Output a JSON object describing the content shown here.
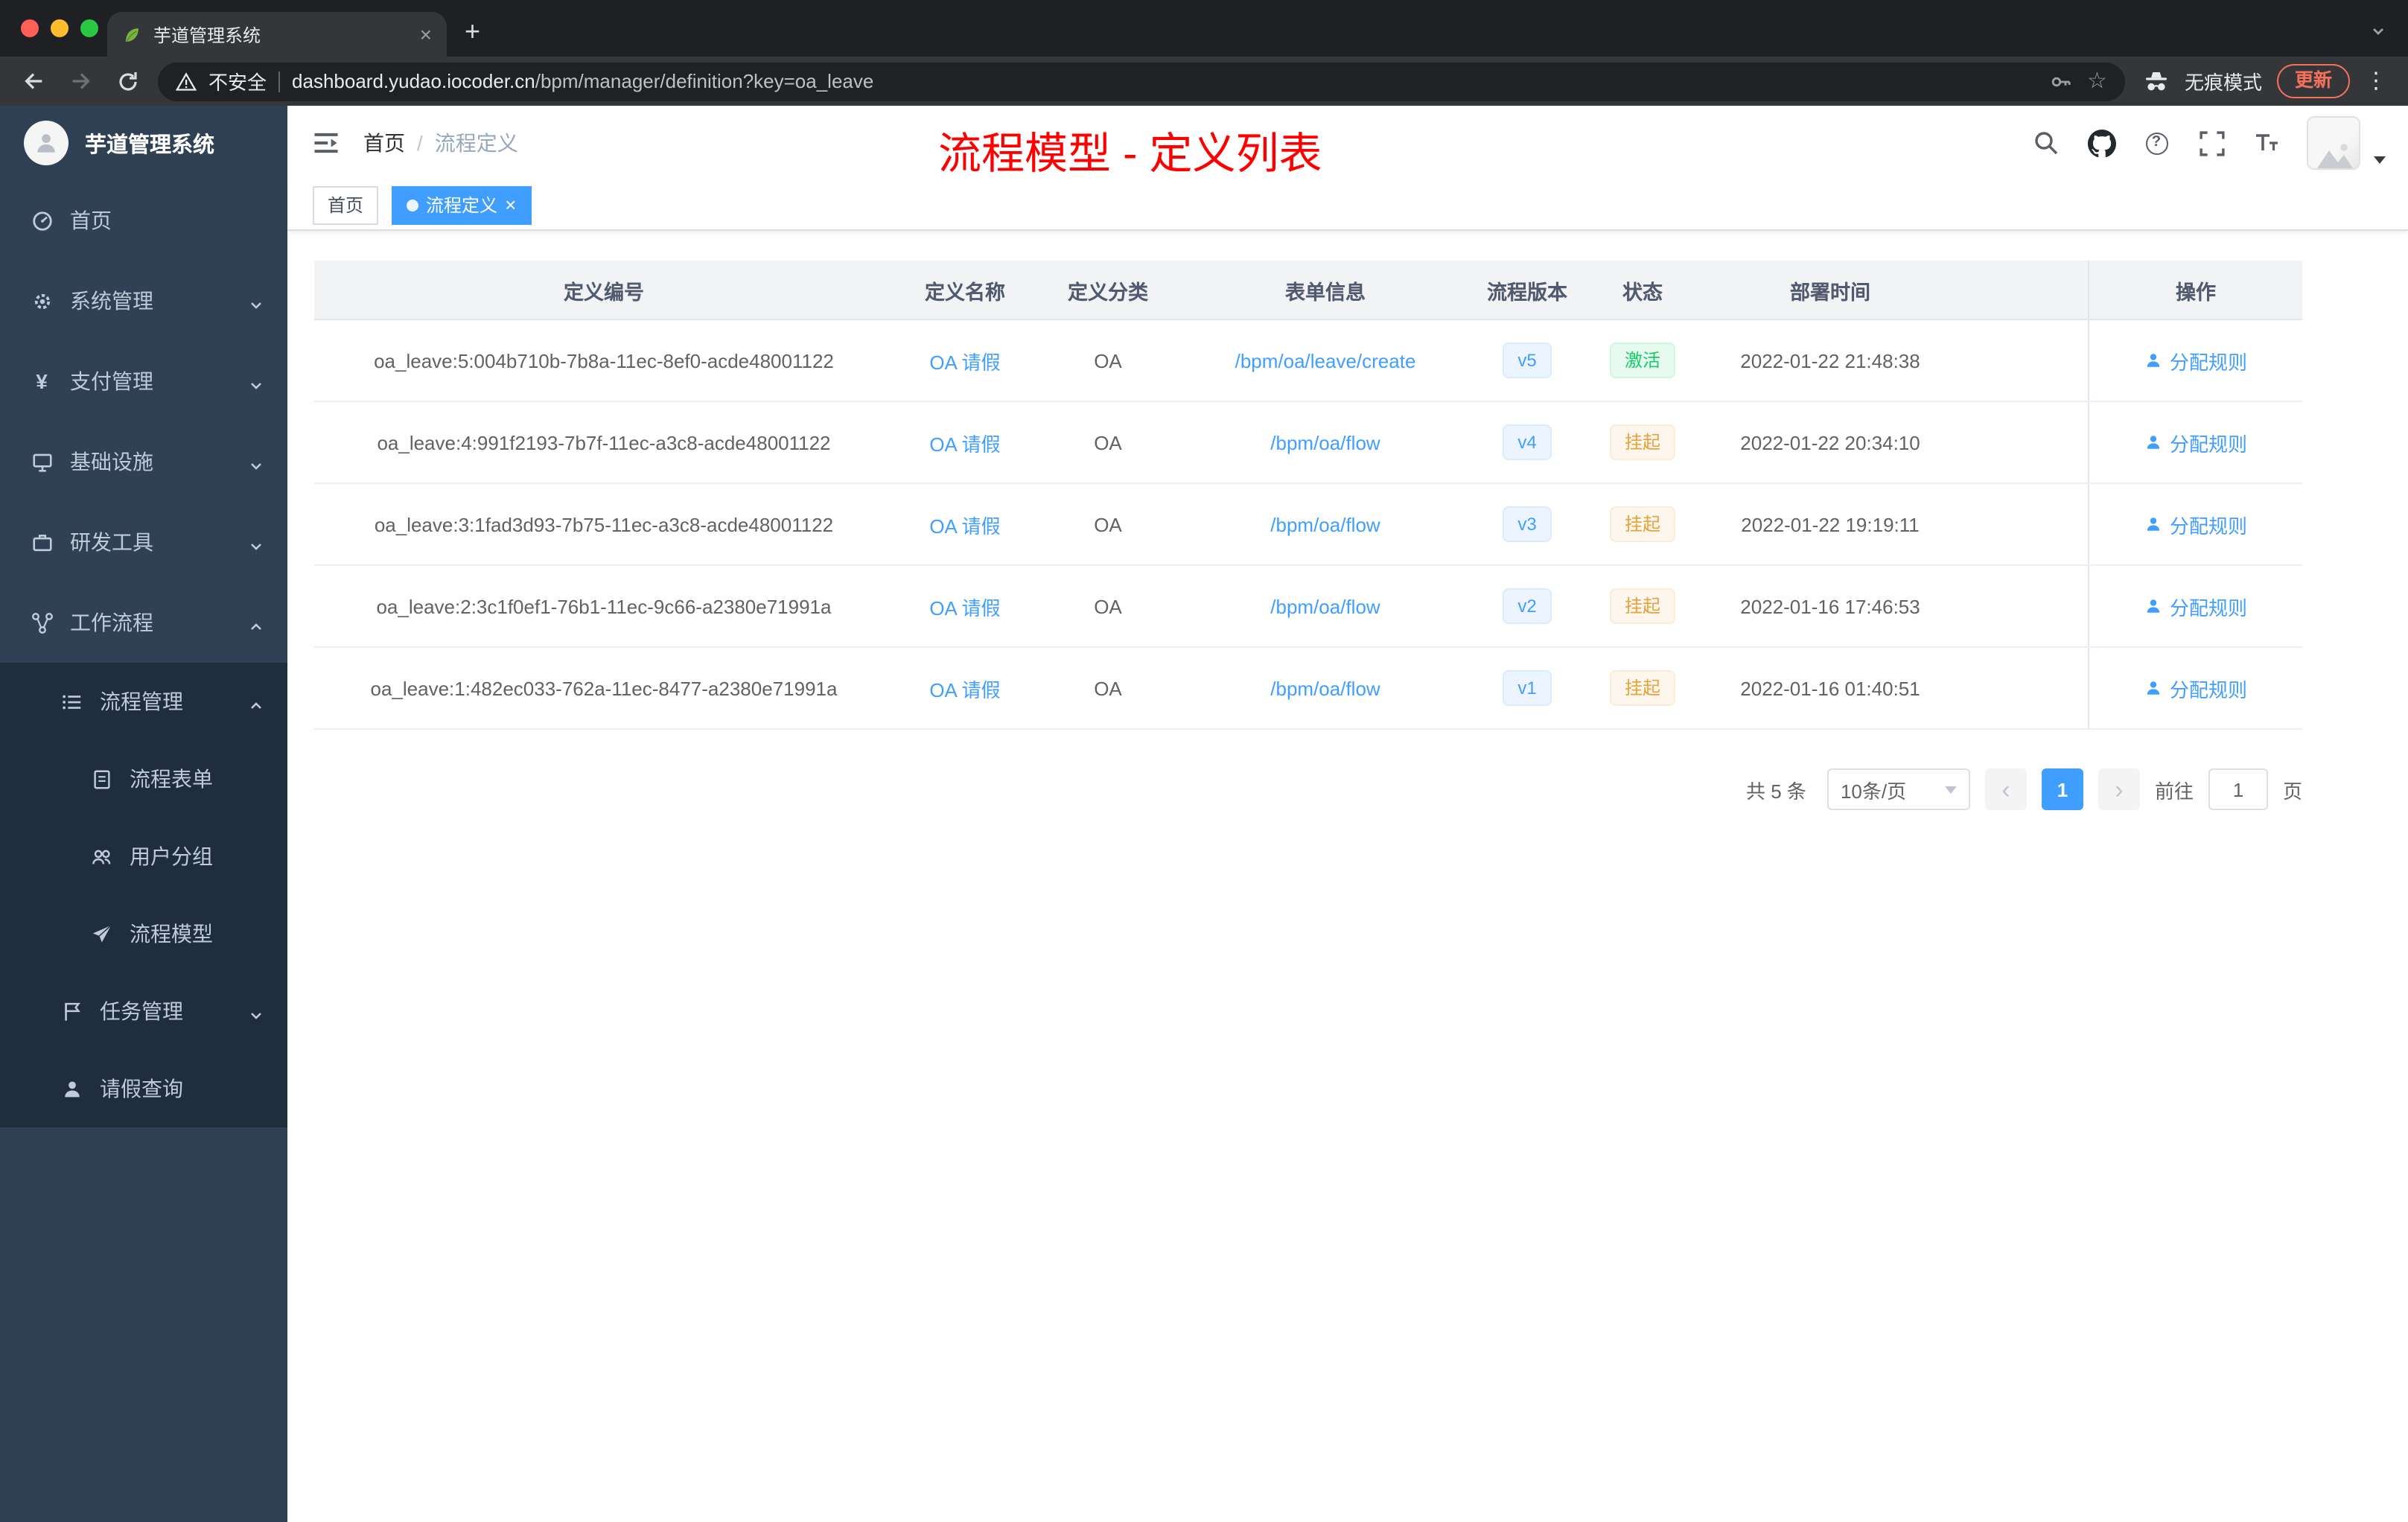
{
  "colors": {
    "accent": "#409eff",
    "success": "#13ce66",
    "warning": "#e6a23c",
    "sidebar_bg": "#304156",
    "annotation_red": "#ff0000"
  },
  "browser": {
    "tab_title": "芋道管理系统",
    "security_label": "不安全",
    "url_domain": "dashboard.yudao.iocoder.cn",
    "url_path": "/bpm/manager/definition?key=oa_leave",
    "incognito_label": "无痕模式",
    "update_label": "更新"
  },
  "icons": {
    "close": "×",
    "new_tab": "+",
    "menu_dots": "⋮",
    "star": "☆",
    "question": "?",
    "yen": "¥",
    "prev": "‹",
    "next": "›"
  },
  "sidebar": {
    "title": "芋道管理系统",
    "menu": [
      {
        "label": "首页"
      },
      {
        "label": "系统管理"
      },
      {
        "label": "支付管理"
      },
      {
        "label": "基础设施"
      },
      {
        "label": "研发工具"
      },
      {
        "label": "工作流程"
      },
      {
        "label": "流程管理"
      },
      {
        "label": "流程表单"
      },
      {
        "label": "用户分组"
      },
      {
        "label": "流程模型"
      },
      {
        "label": "任务管理"
      },
      {
        "label": "请假查询"
      }
    ]
  },
  "header": {
    "breadcrumb_home": "首页",
    "breadcrumb_sep": "/",
    "breadcrumb_current": "流程定义",
    "annotation": "流程模型 - 定义列表"
  },
  "tags": {
    "home": "首页",
    "current": "流程定义"
  },
  "table": {
    "columns": [
      "定义编号",
      "定义名称",
      "定义分类",
      "表单信息",
      "流程版本",
      "状态",
      "部署时间",
      "操作"
    ],
    "rows": [
      {
        "id": "oa_leave:5:004b710b-7b8a-11ec-8ef0-acde48001122",
        "name": "OA 请假",
        "category": "OA",
        "form": "/bpm/oa/leave/create",
        "version": "v5",
        "status": "激活",
        "time": "2022-01-22 21:48:38",
        "action": "分配规则"
      },
      {
        "id": "oa_leave:4:991f2193-7b7f-11ec-a3c8-acde48001122",
        "name": "OA 请假",
        "category": "OA",
        "form": "/bpm/oa/flow",
        "version": "v4",
        "status": "挂起",
        "time": "2022-01-22 20:34:10",
        "action": "分配规则"
      },
      {
        "id": "oa_leave:3:1fad3d93-7b75-11ec-a3c8-acde48001122",
        "name": "OA 请假",
        "category": "OA",
        "form": "/bpm/oa/flow",
        "version": "v3",
        "status": "挂起",
        "time": "2022-01-22 19:19:11",
        "action": "分配规则"
      },
      {
        "id": "oa_leave:2:3c1f0ef1-76b1-11ec-9c66-a2380e71991a",
        "name": "OA 请假",
        "category": "OA",
        "form": "/bpm/oa/flow",
        "version": "v2",
        "status": "挂起",
        "time": "2022-01-16 17:46:53",
        "action": "分配规则"
      },
      {
        "id": "oa_leave:1:482ec033-762a-11ec-8477-a2380e71991a",
        "name": "OA 请假",
        "category": "OA",
        "form": "/bpm/oa/flow",
        "version": "v1",
        "status": "挂起",
        "time": "2022-01-16 01:40:51",
        "action": "分配规则"
      }
    ]
  },
  "pagination": {
    "total": "共 5 条",
    "page_size": "10条/页",
    "current": "1",
    "goto_label": "前往",
    "goto_value": "1",
    "unit": "页"
  }
}
